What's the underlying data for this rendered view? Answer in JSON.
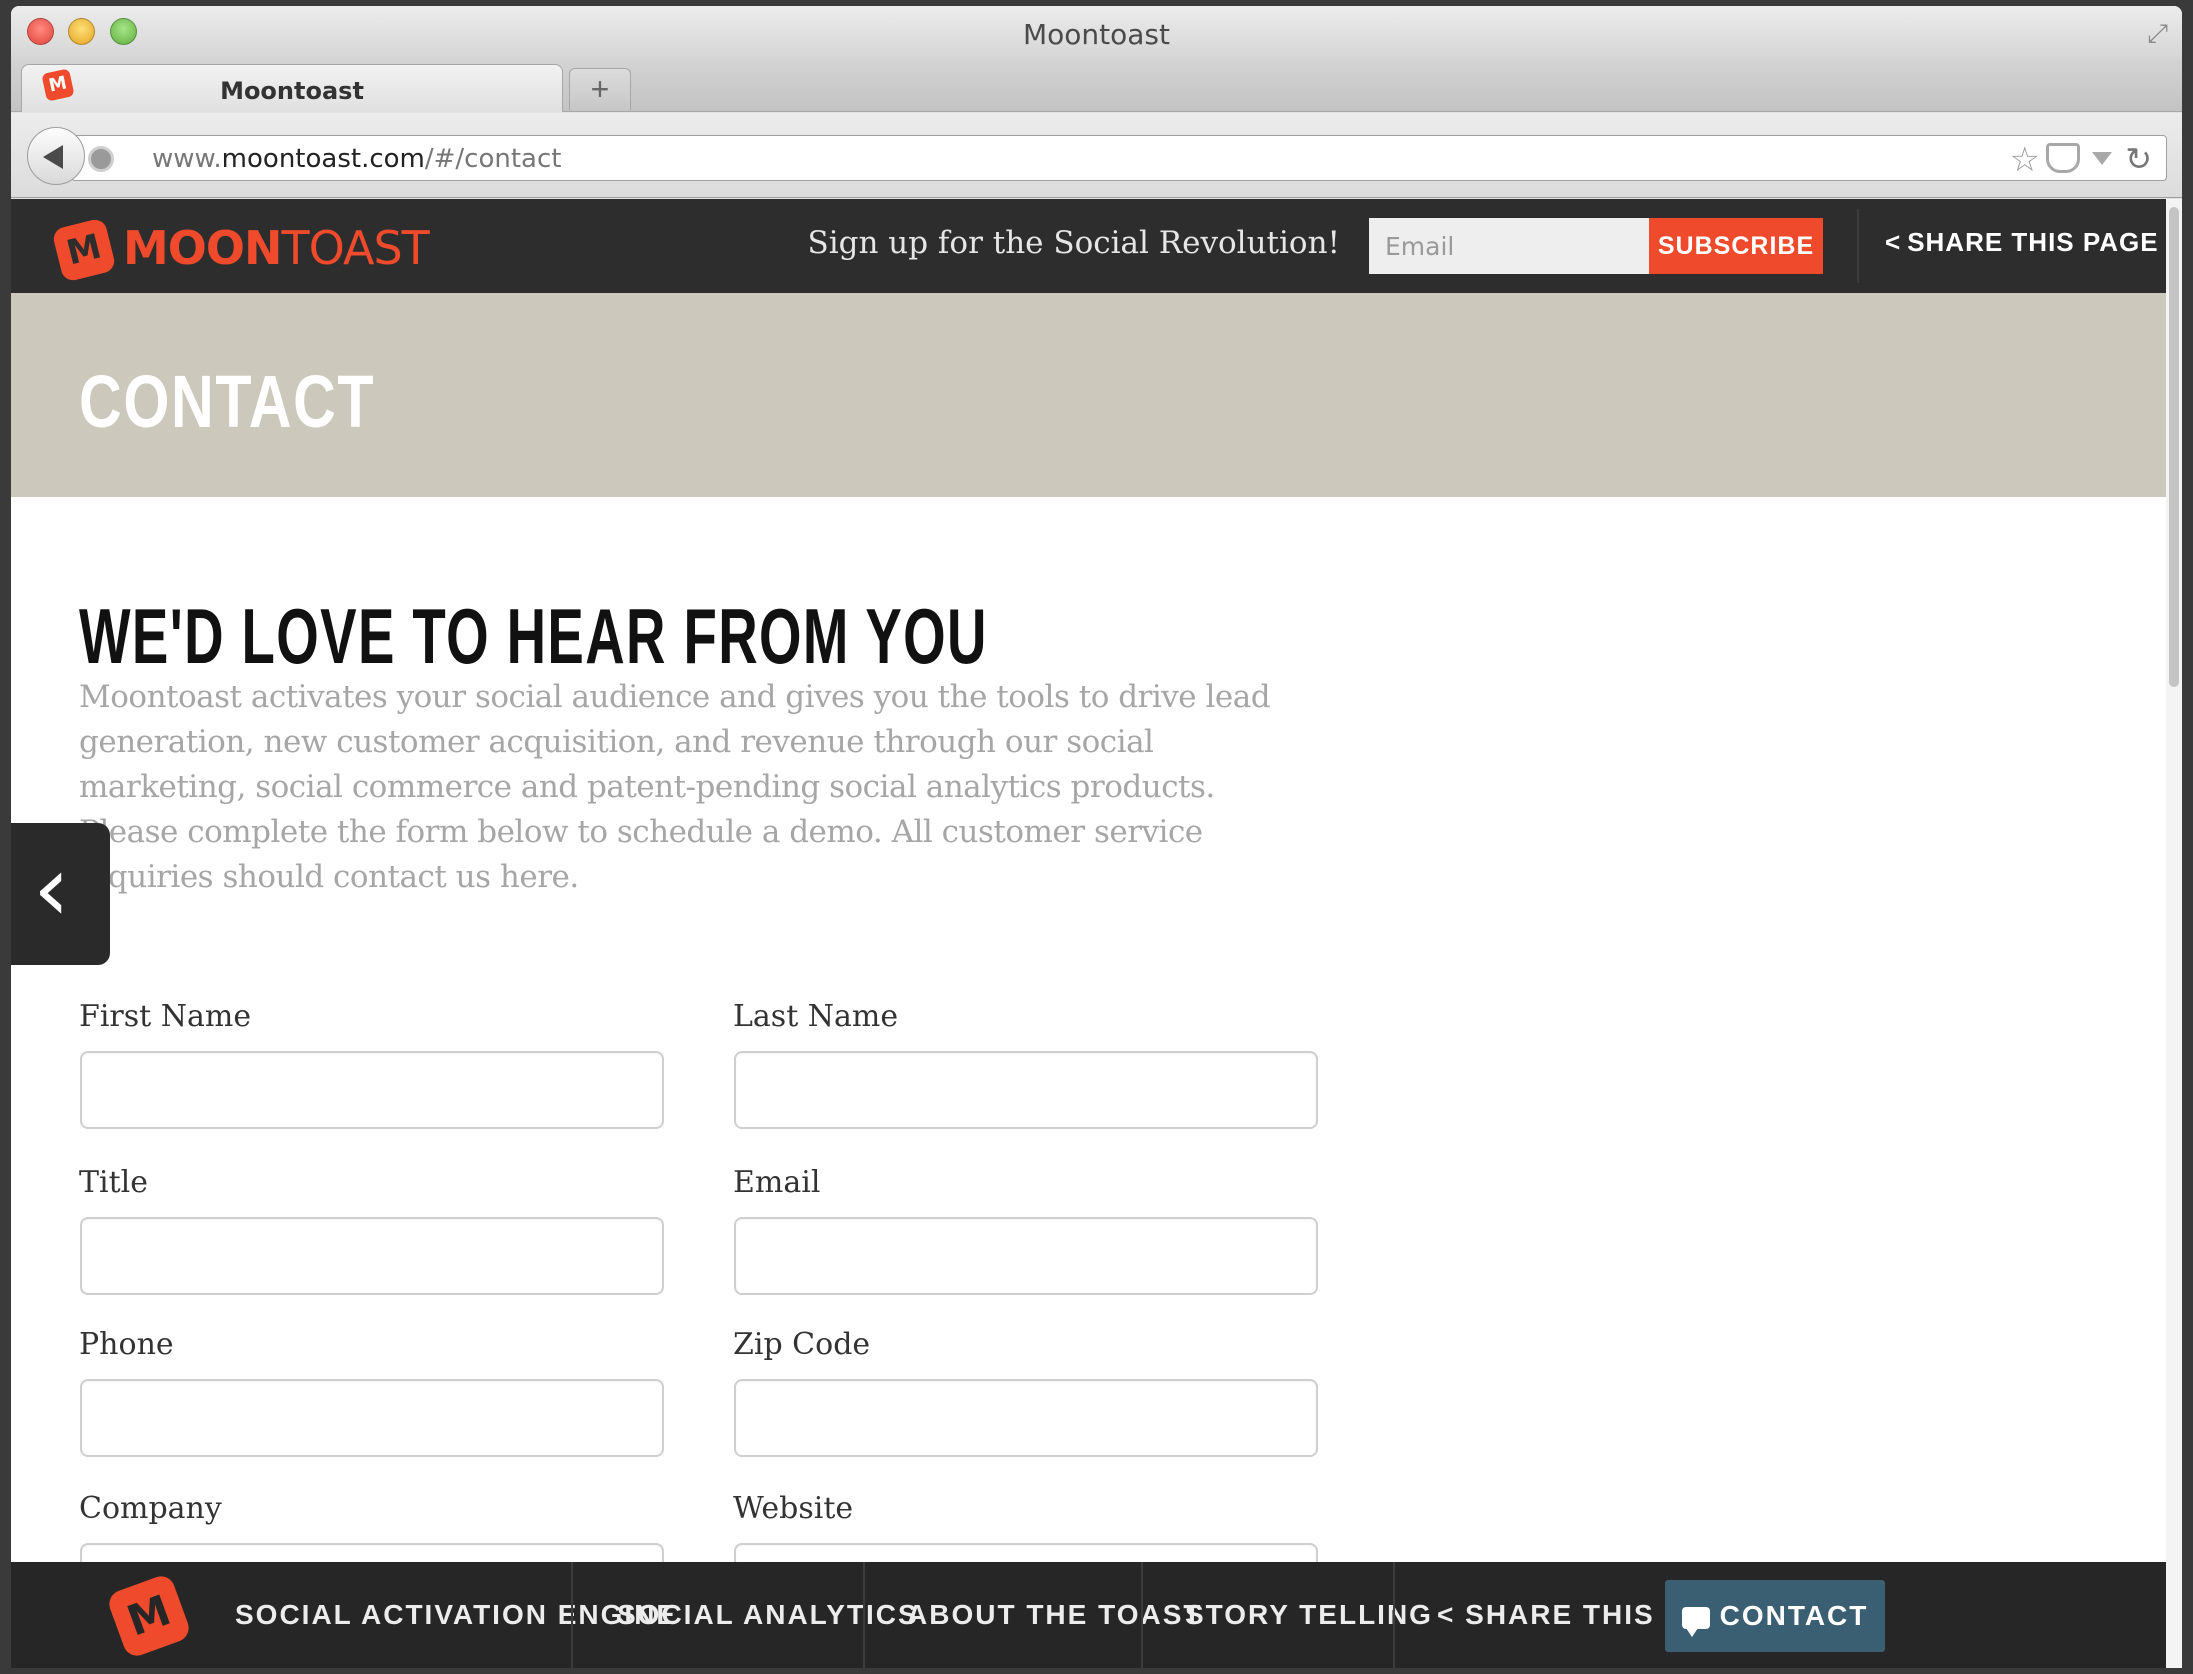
{
  "browser": {
    "window_title": "Moontoast",
    "tab_title": "Moontoast",
    "new_tab_label": "+",
    "url_prefix": "www.",
    "url_domain": "moontoast.com",
    "url_path": "/#/contact"
  },
  "header": {
    "logo_bold": "MOON",
    "logo_light": "TOAST",
    "logo_mark": "M",
    "signup_text": "Sign up for the Social Revolution!",
    "email_placeholder": "Email",
    "subscribe_label": "SUBSCRIBE",
    "share_label": "SHARE THIS PAGE"
  },
  "hero": {
    "title": "CONTACT"
  },
  "main": {
    "heading": "WE'D LOVE TO HEAR FROM YOU",
    "intro": "Moontoast activates your social audience and gives you the tools to drive lead generation, new customer acquisition, and revenue through our social marketing, social commerce and patent-pending social analytics products. Please complete the form below to schedule a demo. All customer service inquiries should contact us here."
  },
  "form": {
    "first_name_label": "First Name",
    "last_name_label": "Last Name",
    "title_label": "Title",
    "email_label": "Email",
    "phone_label": "Phone",
    "zip_label": "Zip Code",
    "company_label": "Company",
    "website_label": "Website"
  },
  "bottom_nav": {
    "logo_mark": "M",
    "items": [
      "SOCIAL ACTIVATION ENGINE",
      "SOCIAL ANALYTICS",
      "ABOUT THE TOAST",
      "STORY TELLING",
      "SHARE THIS"
    ],
    "contact_label": "CONTACT US"
  },
  "colors": {
    "brand_orange": "#ef4a2b",
    "header_bg": "#2d2d2d",
    "hero_bg": "#cdc8bc",
    "contact_button_bg": "#3b5f72"
  },
  "icons": [
    "back-arrow-icon",
    "globe-icon",
    "star-icon",
    "pocket-icon",
    "dropdown-icon",
    "reload-icon",
    "share-icon",
    "chevron-left-icon",
    "chat-icon",
    "fullscreen-icon"
  ]
}
